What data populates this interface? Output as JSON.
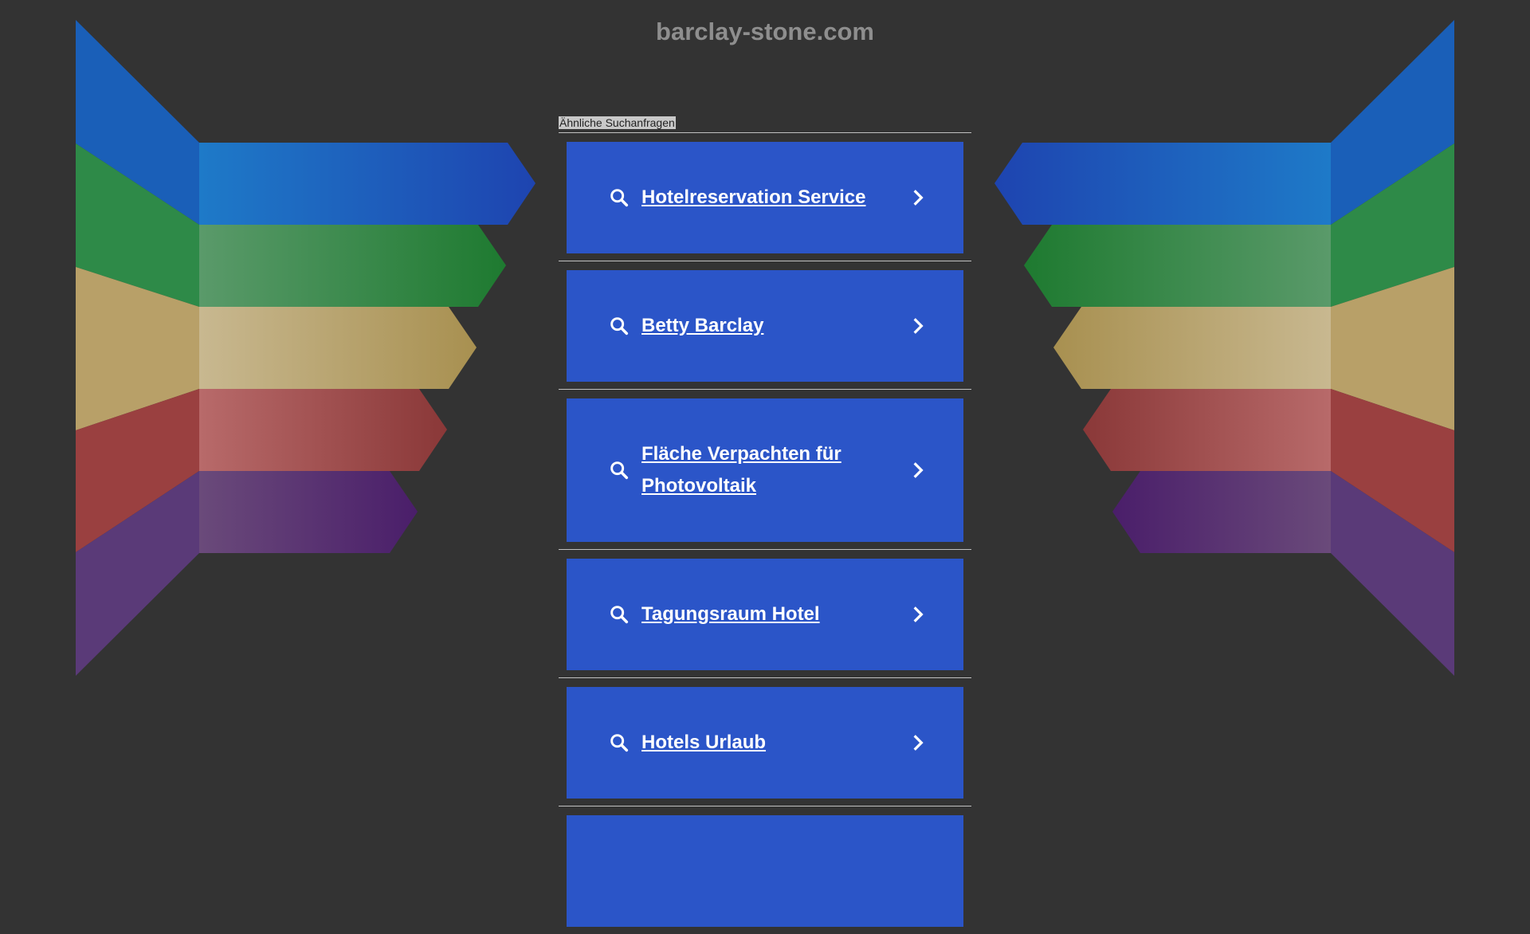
{
  "page": {
    "domain": "barclay-stone.com",
    "related_label": "Ähnliche Suchanfragen"
  },
  "results": [
    {
      "label": "Hotelreservation Service"
    },
    {
      "label": "Betty Barclay"
    },
    {
      "label": "Fläche Verpachten für Photovoltaik"
    },
    {
      "label": "Tagungsraum Hotel"
    },
    {
      "label": "Hotels Urlaub"
    },
    {
      "label": ""
    }
  ],
  "icons": {
    "search": "search-icon",
    "arrow": "chevron-right-icon"
  },
  "colors": {
    "background": "#333333",
    "result_block": "#2b55c8",
    "stripes": [
      "#1f5fc0",
      "#2a8a4a",
      "#b8a060",
      "#a04848",
      "#5a3680"
    ]
  }
}
